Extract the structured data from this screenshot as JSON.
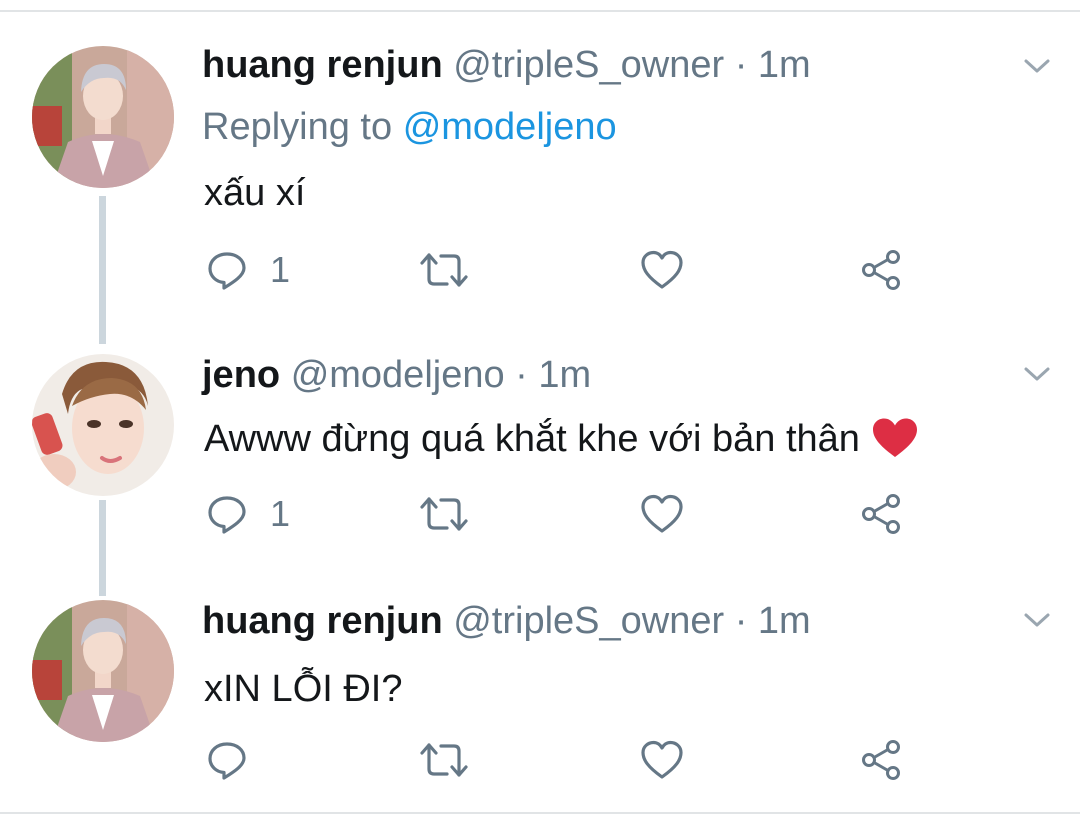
{
  "colors": {
    "name": "#14171a",
    "muted": "#657786",
    "mention": "#1b95e0",
    "thread_line": "#ccd6dd",
    "heart_emoji": "#dd2e44"
  },
  "tweets": [
    {
      "name": "huang renjun",
      "handle": "@tripleS_owner",
      "separator": "·",
      "time": "1m",
      "replying_prefix": "Replying to",
      "replying_handle": "@modeljeno",
      "text": "xấu xí",
      "reply_count": "1",
      "icons": [
        "chevron-down-icon",
        "reply-icon",
        "retweet-icon",
        "like-icon",
        "share-icon"
      ]
    },
    {
      "name": "jeno",
      "handle": "@modeljeno",
      "separator": "·",
      "time": "1m",
      "text": "Awww đừng quá khắt khe với bản thân",
      "emoji": "❤️",
      "reply_count": "1",
      "icons": [
        "chevron-down-icon",
        "reply-icon",
        "retweet-icon",
        "like-icon",
        "share-icon"
      ]
    },
    {
      "name": "huang renjun",
      "handle": "@tripleS_owner",
      "separator": "·",
      "time": "1m",
      "text": "xIN LỖI ĐI?",
      "reply_count": "",
      "icons": [
        "chevron-down-icon",
        "reply-icon",
        "retweet-icon",
        "like-icon",
        "share-icon"
      ]
    }
  ]
}
